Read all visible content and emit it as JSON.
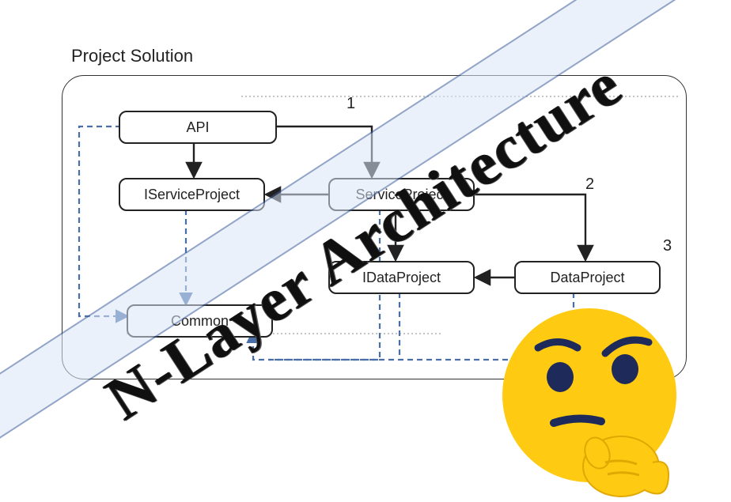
{
  "title": "Project Solution",
  "overlay": "N-Layer Architecture",
  "boxes": {
    "api": "API",
    "iservice": "IServiceProject",
    "service": "ServiceProject",
    "idata": "IDataProject",
    "data": "DataProject",
    "common": "Common"
  },
  "numbers": {
    "n1": "1",
    "n2": "2",
    "n3": "3"
  },
  "colors": {
    "solid": "#222222",
    "dashed": "#4a6fa8",
    "band": "#d9e6f7",
    "emoji_body": "#ffcb12",
    "emoji_dark": "#1e2a5a"
  }
}
